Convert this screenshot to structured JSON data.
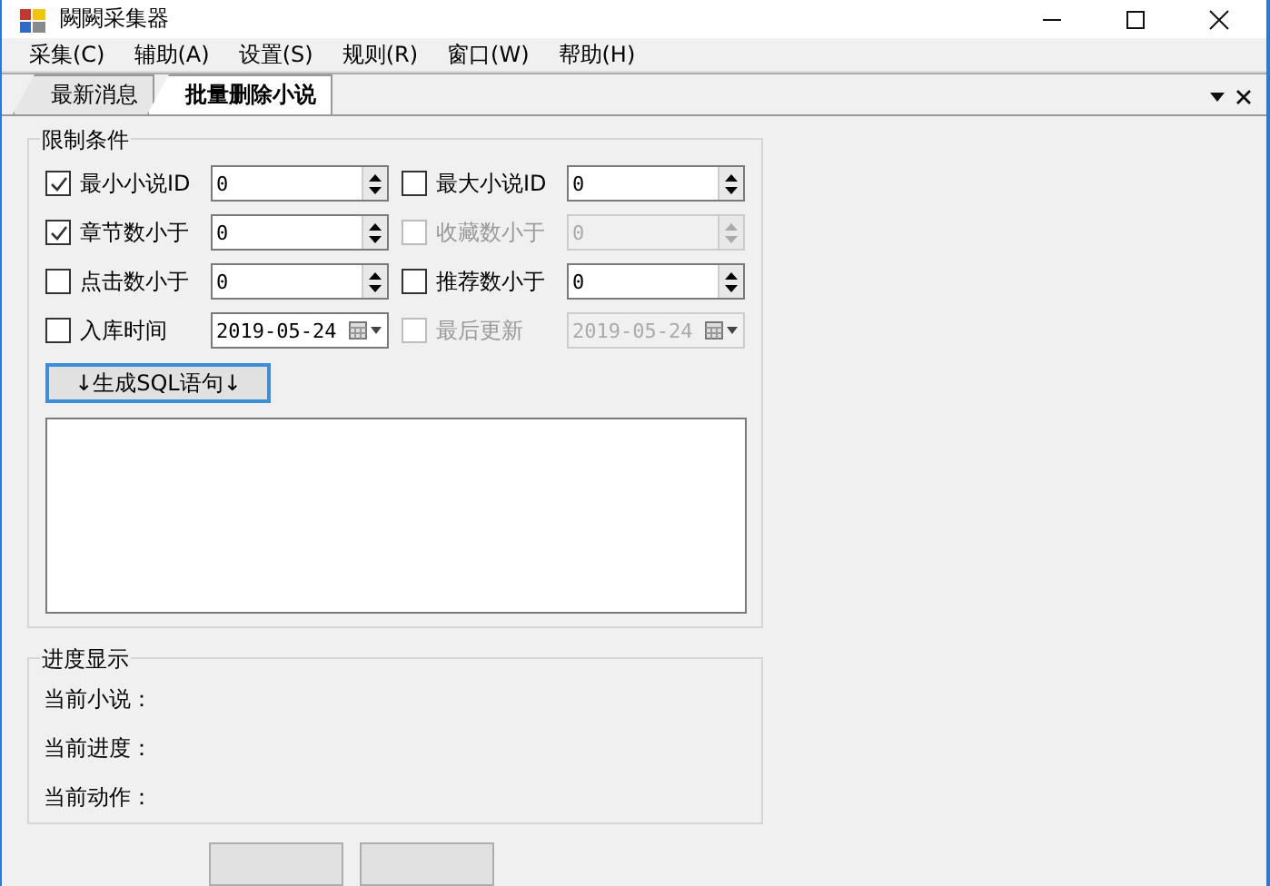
{
  "window": {
    "title": "闕闕采集器"
  },
  "menu": [
    {
      "label": "采集(C)"
    },
    {
      "label": "辅助(A)"
    },
    {
      "label": "设置(S)"
    },
    {
      "label": "规则(R)"
    },
    {
      "label": "窗口(W)"
    },
    {
      "label": "帮助(H)"
    }
  ],
  "tabs": [
    {
      "label": "最新消息",
      "selected": false
    },
    {
      "label": "批量删除小说",
      "selected": true
    }
  ],
  "filter_group": {
    "title": "限制条件",
    "filters": [
      {
        "kind": "spin",
        "label": "最小小说ID",
        "checked": true,
        "disabled": false,
        "value": "0"
      },
      {
        "kind": "spin",
        "label": "最大小说ID",
        "checked": false,
        "disabled": false,
        "value": "0"
      },
      {
        "kind": "spin",
        "label": "章节数小于",
        "checked": true,
        "disabled": false,
        "value": "0"
      },
      {
        "kind": "spin",
        "label": "收藏数小于",
        "checked": false,
        "disabled": true,
        "value": "0"
      },
      {
        "kind": "spin",
        "label": "点击数小于",
        "checked": false,
        "disabled": false,
        "value": "0"
      },
      {
        "kind": "spin",
        "label": "推荐数小于",
        "checked": false,
        "disabled": false,
        "value": "0"
      },
      {
        "kind": "date",
        "label": "入库时间",
        "checked": false,
        "disabled": false,
        "value": "2019-05-24"
      },
      {
        "kind": "date",
        "label": "最后更新",
        "checked": false,
        "disabled": true,
        "value": "2019-05-24"
      }
    ],
    "button": "↓生成SQL语句↓"
  },
  "progress_group": {
    "title": "进度显示",
    "lines": [
      "当前小说：",
      "当前进度：",
      "当前动作："
    ]
  }
}
